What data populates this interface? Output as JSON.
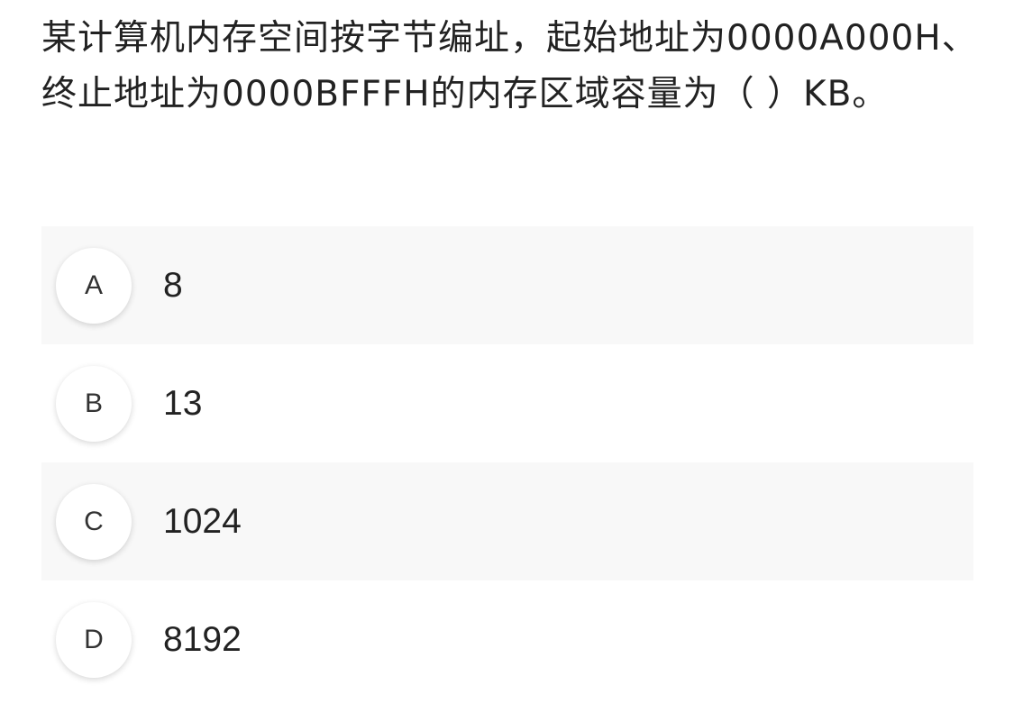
{
  "question": {
    "text": "某计算机内存空间按字节编址，起始地址为0000A000H、终止地址为0000BFFFH的内存区域容量为（ ）KB。"
  },
  "options": [
    {
      "letter": "A",
      "text": "8"
    },
    {
      "letter": "B",
      "text": "13"
    },
    {
      "letter": "C",
      "text": "1024"
    },
    {
      "letter": "D",
      "text": "8192"
    }
  ],
  "colors": {
    "shaded_row": "#f8f8f8",
    "text": "#222222",
    "circle_bg": "#ffffff"
  }
}
